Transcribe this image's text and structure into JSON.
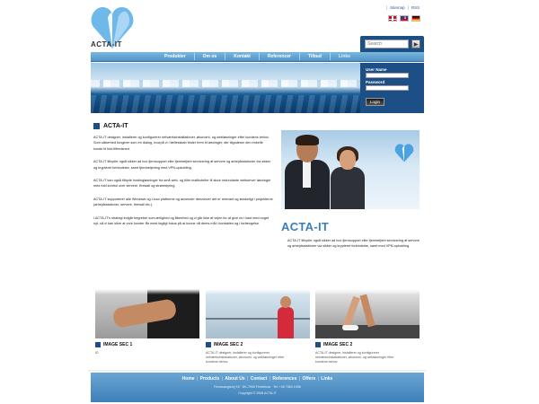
{
  "brand": {
    "name": "ACTA-IT",
    "accent": "#1b4f86",
    "light_accent": "#3a7fb9"
  },
  "toplinks": [
    "Sitemap",
    "RSS"
  ],
  "languages": [
    "Dansk",
    "English",
    "Deutsch"
  ],
  "search": {
    "placeholder": "Search",
    "button_icon": "arrow-right-icon"
  },
  "nav": {
    "items": [
      "Produkter",
      "Om os",
      "Kontakt",
      "Referencer",
      "Tilbud",
      "Links"
    ]
  },
  "login": {
    "username_label": "User Name",
    "password_label": "Password",
    "button_label": "Login"
  },
  "main": {
    "title": "ACTA-IT",
    "paragraphs": [
      "ACTA-IT designer, installerer og konfigurerer netværksinstallationer, økonomi- og webløsninger efter kundens behov. Som sikkerhed fungerer som en dialog, hvorpå vi i fællesskab finder frem til løsninger, der tilgodeser den enkelte kunde til fuld tilfredshed.",
      "ACTA-IT tilbyder også sikker ad hoc fjernsupport eller fjernbetjent servicering af servere og arbejdsstationer via sikker og krypteret forbindelse, samt fjernbetjening med VPN-opkobling.",
      "ACTA-IT kan også tilbyde hostingløsninger fra små web- og tiller mailhoteller til store redundante webserver løsninger med fuld kontrol over servere, firewall og strømstyring.",
      "ACTA-IT supporterer alle Windows og Linux platforme og anvender derudover det er relevant og ønskeligt i projekterne (arbejdsstationer, servere, firewall etc.).",
      "I ACTA-IT's strategi indgår begreber som ærlighed og åbenhed og vi går ikke af vejen for at give os i kast med noget nyt, så vi kan sikre at vore kunder får mest fagligt fokus på at kunne nå deres mål i kontakten og i forlængelse."
    ]
  },
  "feature": {
    "title": "ACTA-IT",
    "text": "ACTA-IT tilbyder også sikker ad hoc fjernsupport eller fjernbetjent servicering af servere og arbejdsstationer via sikker og krypteret forbindelse, samt med VPN-opkobling."
  },
  "thumbs": [
    {
      "title": "IMAGE SEC 1",
      "text": "ID"
    },
    {
      "title": "IMAGE SEC 2",
      "text": "ACTA-IT designer, installerer og konfigurerer netværksinstallationer, økonomi- og webløsninger efter kundens behov."
    },
    {
      "title": "IMAGE SEC 2",
      "text": "ACTA-IT designer, installerer og konfigurerer netværksinstallationer, økonomi- og webløsninger efter kundens behov."
    }
  ],
  "footer": {
    "links": [
      "Home",
      "Products",
      "About Us",
      "Contact",
      "References",
      "Offers",
      "Links"
    ],
    "address": "Firmavangsvej 18 · DK-7900 Fredericia · Tel: +45 7584 1958",
    "copyright": "Copyright © 2008 ACTA-IT"
  }
}
